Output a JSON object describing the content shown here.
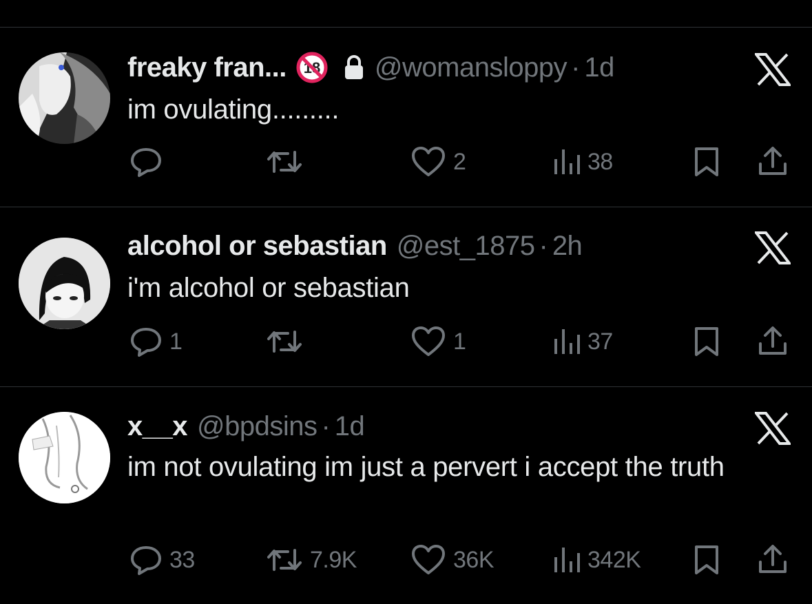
{
  "tweets": [
    {
      "name": "freaky fran...",
      "handle": "@womansloppy",
      "separator": "·",
      "time": "1d",
      "has_badge": true,
      "badge_icon": "no-under-18-icon",
      "locked": true,
      "text": "im ovulating.........",
      "replies": "",
      "retweets": "",
      "likes": "2",
      "views": "38"
    },
    {
      "name": "alcohol or sebastian",
      "handle": "@est_1875",
      "separator": "·",
      "time": "2h",
      "has_badge": false,
      "locked": false,
      "text": "i'm alcohol or sebastian",
      "replies": "1",
      "retweets": "",
      "likes": "1",
      "views": "37"
    },
    {
      "name": "x__x",
      "handle": "@bpdsins",
      "separator": "·",
      "time": "1d",
      "has_badge": false,
      "locked": false,
      "text": "im not ovulating im just a pervert i accept the truth",
      "replies": "33",
      "retweets": "7.9K",
      "likes": "36K",
      "views": "342K"
    }
  ],
  "colors": {
    "background": "#000000",
    "text": "#e7e9ea",
    "muted": "#71767b",
    "divider": "#2f3336",
    "badge_red": "#e0245e"
  },
  "icons": {
    "reply": "reply-icon",
    "retweet": "retweet-icon",
    "like": "heart-icon",
    "views": "views-icon",
    "bookmark": "bookmark-icon",
    "share": "share-icon",
    "logo": "x-logo-icon",
    "lock": "lock-icon"
  }
}
